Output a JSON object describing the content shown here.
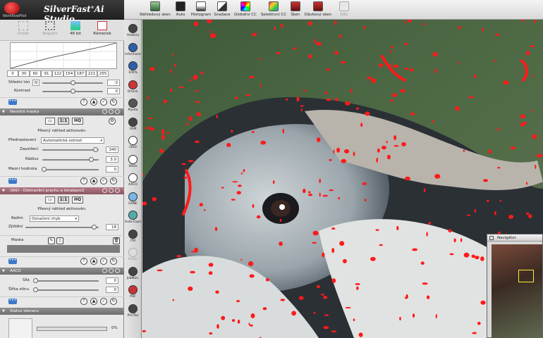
{
  "app": {
    "brand": "SilverFast",
    "brand_suffix": "Ai Studio",
    "logo_caption": "WorkflowPilot"
  },
  "toolbar": [
    {
      "label": "Náhledový sken",
      "icon": "prescan-icon"
    },
    {
      "label": "Auto",
      "icon": "auto-icon"
    },
    {
      "label": "Histogram",
      "icon": "histogram-icon"
    },
    {
      "label": "Gradace",
      "icon": "gradation-icon"
    },
    {
      "label": "Globální CC",
      "icon": "global-cc-icon"
    },
    {
      "label": "Selektivní CC",
      "icon": "selective-cc-icon"
    },
    {
      "label": "Sken",
      "icon": "scan-icon"
    },
    {
      "label": "Dávkový sken",
      "icon": "batch-scan-icon"
    },
    {
      "label": "SAC",
      "icon": "sac-icon",
      "disabled": true
    }
  ],
  "modes": [
    {
      "label": "Držák",
      "icon": "holder-icon",
      "dim": true
    },
    {
      "label": "Negativ",
      "icon": "negative-icon",
      "dim": true
    },
    {
      "label": "48 bit",
      "icon": "48bit-icon",
      "dim": false
    },
    {
      "label": "Rámeček",
      "icon": "frame-icon",
      "dim": false
    }
  ],
  "curve_values": [
    "0",
    "30",
    "60",
    "91",
    "122",
    "154",
    "187",
    "221",
    "255"
  ],
  "midtone": {
    "label": "Střední tón",
    "unit": "N",
    "value": "-3"
  },
  "contrast": {
    "label": "Kontrast",
    "value": "0"
  },
  "usm": {
    "header": "Neostrá maska",
    "preview_1": "1:1",
    "preview_hq": "HQ",
    "note": "Přesný náhled aktivován.",
    "preset_label": "Přednastavení",
    "preset_value": "Automatická ostrost",
    "amount_label": "Zaostření",
    "amount_value": "340",
    "radius_label": "Rádius",
    "radius_value": "3.0",
    "threshold_label": "Mezní hodnota",
    "threshold_value": "0"
  },
  "isrd": {
    "header": "iSRD - Odstranění prachu a škrabanců",
    "preview_1": "1:1",
    "preview_hq": "HQ",
    "note": "Přesný náhled aktivován.",
    "mode_label": "Režim",
    "mode_value": "Označení chyb",
    "detect_label": "Zjištění",
    "detect_value": "18",
    "mask_label": "Maska"
  },
  "aaco": {
    "header": "AACO",
    "strength_label": "Síla",
    "strength_value": "0",
    "shadow_label": "Šířka stínu",
    "shadow_value": "0"
  },
  "status": {
    "header": "Status skeneru",
    "percent": "0%",
    "progress": 0
  },
  "tools": [
    {
      "label": "Historie",
      "icon": "history-icon"
    },
    {
      "label": "Informace",
      "icon": "info-icon"
    },
    {
      "label": "100%",
      "icon": "zoom-icon"
    },
    {
      "label": "Orient.",
      "icon": "orientation-icon"
    },
    {
      "label": "Pipeta",
      "icon": "pipette-icon"
    },
    {
      "label": "USM",
      "icon": "usm-icon"
    },
    {
      "label": "iSRD",
      "icon": "isrd-icon"
    },
    {
      "label": "SRDx",
      "icon": "srdx-icon"
    },
    {
      "label": "AACO",
      "icon": "aaco-icon"
    },
    {
      "label": "GANE",
      "icon": "gane-icon"
    },
    {
      "label": "Auto-Expo",
      "icon": "auto-expo-icon"
    },
    {
      "label": "ITB",
      "icon": "itb-icon"
    },
    {
      "label": "Kalibr.",
      "icon": "calibration-icon",
      "dim": true
    },
    {
      "label": "JobMan.",
      "icon": "jobmanager-icon"
    },
    {
      "label": "PDF",
      "icon": "pdf-icon"
    },
    {
      "label": "PrinTao",
      "icon": "printao-icon"
    }
  ],
  "navigator": {
    "title": "Navigátor"
  },
  "colors": {
    "accent_blue": "#3d78c8",
    "defect_red": "#ff1a1a",
    "isrd_header": "#a06773"
  }
}
